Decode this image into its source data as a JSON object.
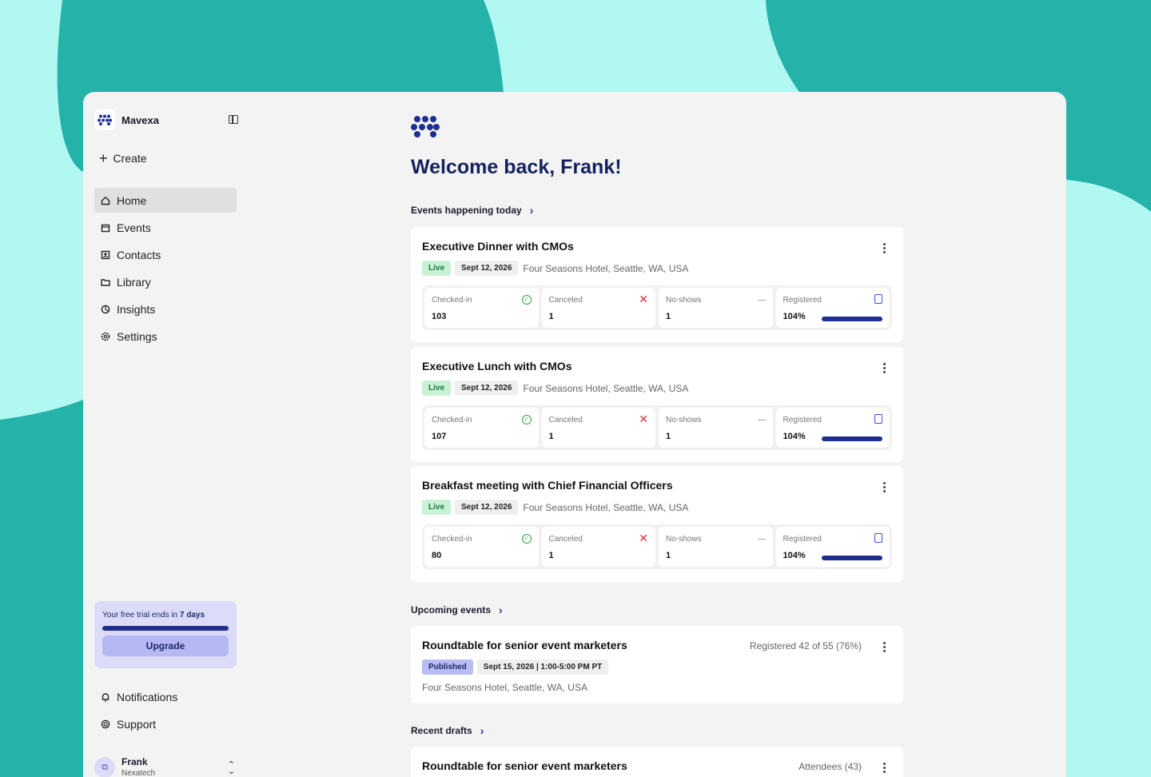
{
  "sidebar": {
    "brand": "Mavexa",
    "create_label": "Create",
    "nav": [
      {
        "label": "Home",
        "icon": "home-icon"
      },
      {
        "label": "Events",
        "icon": "calendar-icon"
      },
      {
        "label": "Contacts",
        "icon": "contacts-icon"
      },
      {
        "label": "Library",
        "icon": "folder-icon"
      },
      {
        "label": "Insights",
        "icon": "chart-pie-icon"
      },
      {
        "label": "Settings",
        "icon": "gear-icon"
      }
    ],
    "trial": {
      "prefix": "Your free trial ends in ",
      "days": "7 days",
      "button": "Upgrade"
    },
    "bottom_nav": [
      {
        "label": "Notifications",
        "icon": "bell-icon"
      },
      {
        "label": "Support",
        "icon": "lifebuoy-icon"
      }
    ],
    "user": {
      "name": "Frank",
      "org": "Nexatech"
    }
  },
  "main": {
    "welcome": "Welcome back, Frank!",
    "today_title": "Events happening today",
    "today_events": [
      {
        "title": "Executive Dinner with CMOs",
        "status": "Live",
        "date": "Sept 12, 2026",
        "location": "Four Seasons Hotel, Seattle, WA, USA",
        "checked_in_label": "Checked-in",
        "checked_in": "103",
        "canceled_label": "Canceled",
        "canceled": "1",
        "no_shows_label": "No-shows",
        "no_shows": "1",
        "registered_label": "Registered",
        "registered": "104%"
      },
      {
        "title": "Executive Lunch with CMOs",
        "status": "Live",
        "date": "Sept 12, 2026",
        "location": "Four Seasons Hotel, Seattle, WA, USA",
        "checked_in_label": "Checked-in",
        "checked_in": "107",
        "canceled_label": "Canceled",
        "canceled": "1",
        "no_shows_label": "No-shows",
        "no_shows": "1",
        "registered_label": "Registered",
        "registered": "104%"
      },
      {
        "title": "Breakfast meeting with Chief Financial Officers",
        "status": "Live",
        "date": "Sept 12, 2026",
        "location": "Four Seasons Hotel, Seattle, WA, USA",
        "checked_in_label": "Checked-in",
        "checked_in": "80",
        "canceled_label": "Canceled",
        "canceled": "1",
        "no_shows_label": "No-shows",
        "no_shows": "1",
        "registered_label": "Registered",
        "registered": "104%"
      }
    ],
    "upcoming_title": "Upcoming events",
    "upcoming": {
      "title": "Roundtable for senior event marketers",
      "status": "Published",
      "date": "Sept 15, 2026 | 1:00-5:00 PM PT",
      "location": "Four Seasons Hotel, Seattle, WA, USA",
      "registered": "Registered 42 of 55 (76%)"
    },
    "drafts_title": "Recent drafts",
    "draft": {
      "title": "Roundtable for senior event marketers",
      "attendees": "Attendees (43)"
    }
  },
  "colors": {
    "teal_bg": "#25b2a9",
    "mint_bg": "#b1f8f2",
    "navy": "#14215e",
    "accent": "#1e2f8f",
    "live_bg": "#c9f1d6",
    "published_bg": "#b9bcf3"
  }
}
